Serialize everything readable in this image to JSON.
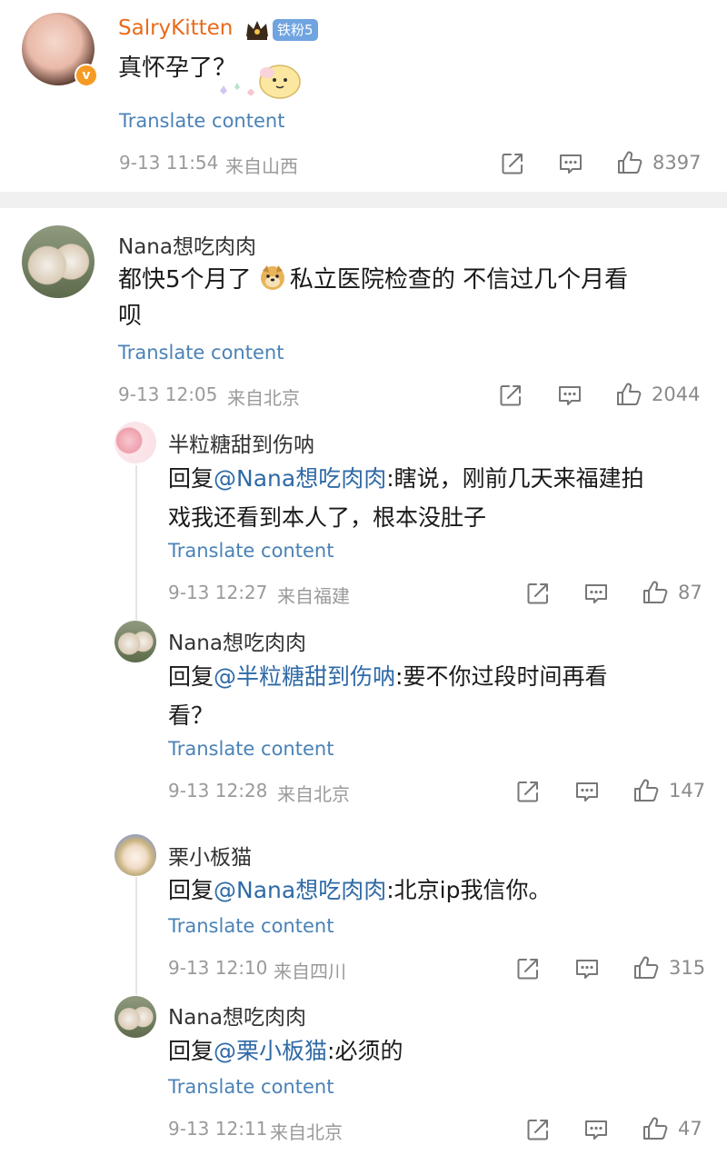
{
  "comments": [
    {
      "name": "SalryKitten",
      "fan_badge": "铁粉5",
      "text": "真怀孕了？",
      "translate": "Translate content",
      "time": "9-13 11:54",
      "location": "来自山西",
      "likes": "8397"
    },
    {
      "name": "Nana想吃肉肉",
      "text_line1": "都快5个月了 ",
      "emoji_name": "doge-emoji",
      "text_line1b": "私立医院检查的 不信过几个月看",
      "text_line2": "呗",
      "translate": "Translate content",
      "time": "9-13 12:05",
      "location": "来自北京",
      "likes": "2044",
      "replies": [
        {
          "name": "半粒糖甜到伤呐",
          "prefix": "回复",
          "mention": "@Nana想吃肉肉",
          "text_line1": ":瞎说，刚前几天来福建拍",
          "text_line2": "戏我还看到本人了，根本没肚子",
          "translate": "Translate content",
          "time": "9-13 12:27",
          "location": "来自福建",
          "likes": "87"
        },
        {
          "name": "Nana想吃肉肉",
          "prefix": "回复",
          "mention": "@半粒糖甜到伤呐",
          "text_line1": ":要不你过段时间再看",
          "text_line2": "看？",
          "translate": "Translate content",
          "time": "9-13 12:28",
          "location": "来自北京",
          "likes": "147"
        },
        {
          "name": "栗小板猫",
          "prefix": "回复",
          "mention": "@Nana想吃肉肉",
          "text_line1": ":北京ip我信你。",
          "translate": "Translate content",
          "time": "9-13 12:10",
          "location": "来自四川",
          "likes": "315"
        },
        {
          "name": "Nana想吃肉肉",
          "prefix": "回复",
          "mention": "@栗小板猫",
          "text_line1": ":必须的",
          "translate": "Translate content",
          "time": "9-13 12:11",
          "location": "来自北京",
          "likes": "47"
        }
      ]
    }
  ],
  "icons": {
    "share": "share-icon",
    "comment": "comment-icon",
    "like": "thumbs-up-icon",
    "crown": "crown-icon",
    "verified": "verified-v-icon"
  },
  "colors": {
    "name_highlight": "#e86b1c",
    "mention": "#2f6aa6",
    "translate": "#4a82b7",
    "meta": "#9a9a9a",
    "fan_badge": "#6fa4e0"
  }
}
